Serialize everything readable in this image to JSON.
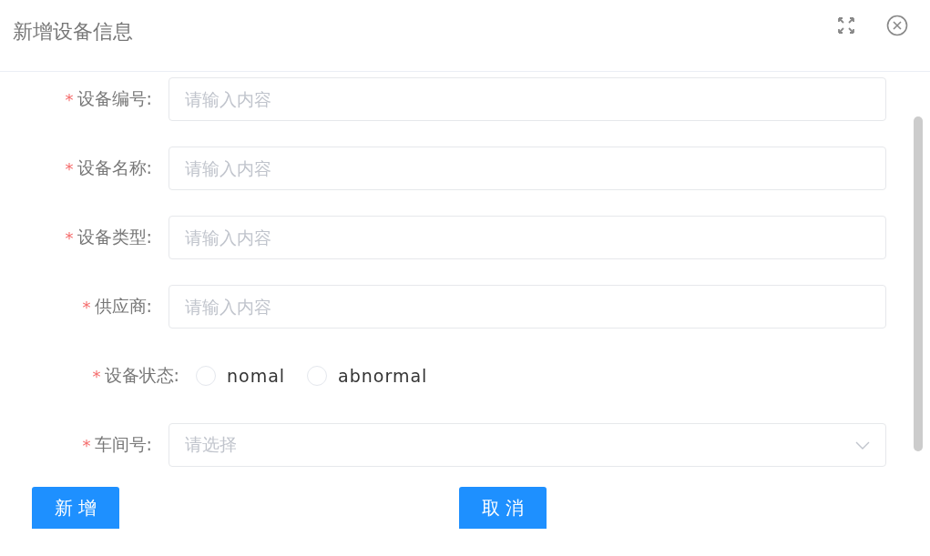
{
  "dialog": {
    "title": "新增设备信息"
  },
  "fields": [
    {
      "kind": "input",
      "label": "设备编号:",
      "required_mark": "*",
      "placeholder": "请输入内容"
    },
    {
      "kind": "input",
      "label": "设备名称:",
      "required_mark": "*",
      "placeholder": "请输入内容"
    },
    {
      "kind": "input",
      "label": "设备类型:",
      "required_mark": "*",
      "placeholder": "请输入内容"
    },
    {
      "kind": "input",
      "label": "供应商:",
      "required_mark": "*",
      "placeholder": "请输入内容"
    },
    {
      "kind": "radio",
      "label": "设备状态:",
      "required_mark": "*",
      "options": [
        {
          "label": "nomal",
          "selected": false
        },
        {
          "label": "abnormal",
          "selected": false
        }
      ]
    },
    {
      "kind": "select",
      "label": "车间号:",
      "required_mark": "*",
      "placeholder": "请选择"
    }
  ],
  "buttons": [
    {
      "label": "新 增"
    },
    {
      "label": "取 消"
    }
  ]
}
